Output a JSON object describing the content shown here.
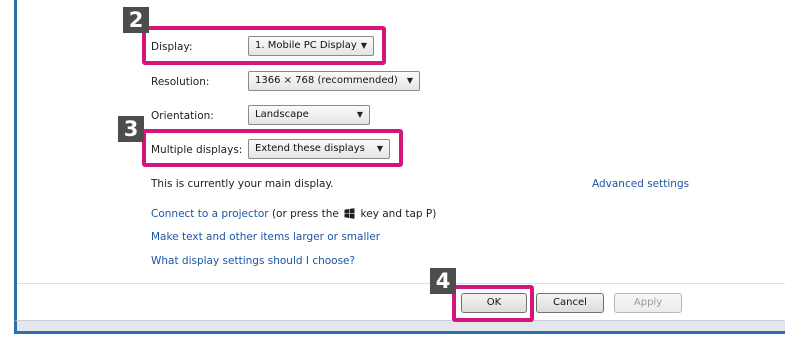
{
  "form": {
    "display": {
      "label": "Display:",
      "value": "1. Mobile PC Display"
    },
    "resolution": {
      "label": "Resolution:",
      "value": "1366 × 768 (recommended)"
    },
    "orientation": {
      "label": "Orientation:",
      "value": "Landscape"
    },
    "multiple_displays": {
      "label": "Multiple displays:",
      "value": "Extend these displays"
    }
  },
  "main_display_text": "This is currently your main display.",
  "advanced_settings": "Advanced settings",
  "links": {
    "projector": "Connect to a projector",
    "projector_suffix_a": "(or press the",
    "projector_suffix_b": "key and tap P)",
    "larger_text": "Make text and other items larger or smaller",
    "which_settings": "What display settings should I choose?"
  },
  "buttons": {
    "ok": "OK",
    "cancel": "Cancel",
    "apply": "Apply"
  },
  "callouts": {
    "step2": "2",
    "step3": "3",
    "step4": "4"
  },
  "colors": {
    "callout_border": "#d4147f",
    "link": "#1b55a6",
    "window_frame": "#2c6fb0"
  }
}
